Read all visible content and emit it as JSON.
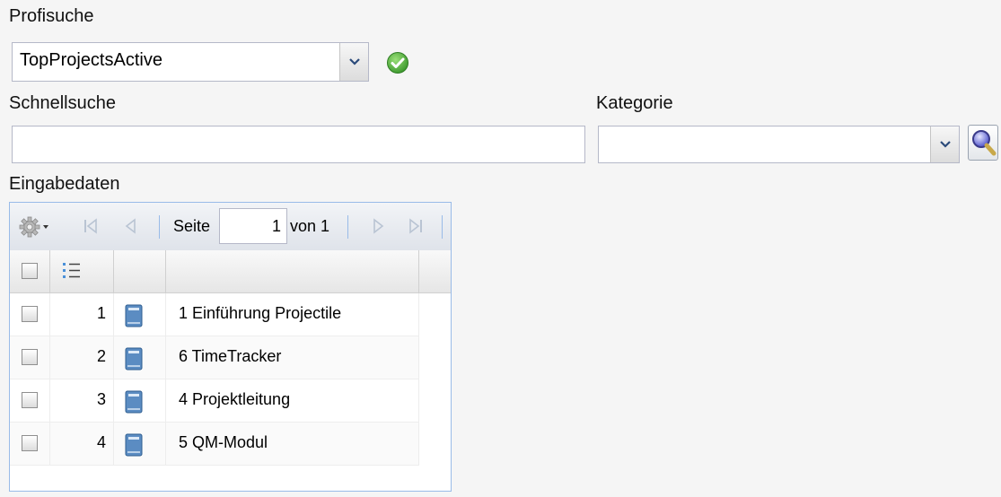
{
  "profisuche": {
    "label": "Profisuche",
    "selected": "TopProjectsActive"
  },
  "schnellsuche": {
    "label": "Schnellsuche",
    "value": ""
  },
  "kategorie": {
    "label": "Kategorie",
    "selected": ""
  },
  "eingabedaten": {
    "label": "Eingabedaten",
    "toolbar": {
      "page_label": "Seite",
      "page_value": "1",
      "of_label": "von 1"
    },
    "rows": [
      {
        "num": "1",
        "text": "1 Einführung Projectile"
      },
      {
        "num": "2",
        "text": "6 TimeTracker"
      },
      {
        "num": "3",
        "text": "4 Projektleitung"
      },
      {
        "num": "4",
        "text": "5 QM-Modul"
      }
    ]
  },
  "icons": {
    "ok": "check-circle-icon",
    "search": "magnifier-icon",
    "settings": "gear-icon",
    "first": "first-page-icon",
    "prev": "prev-page-icon",
    "next": "next-page-icon",
    "last": "last-page-icon",
    "row": "book-icon",
    "numbered": "numbered-list-icon"
  },
  "colors": {
    "accent_border": "#99bbe8",
    "ok_green": "#4caf50",
    "book_blue": "#4a7fb5"
  }
}
